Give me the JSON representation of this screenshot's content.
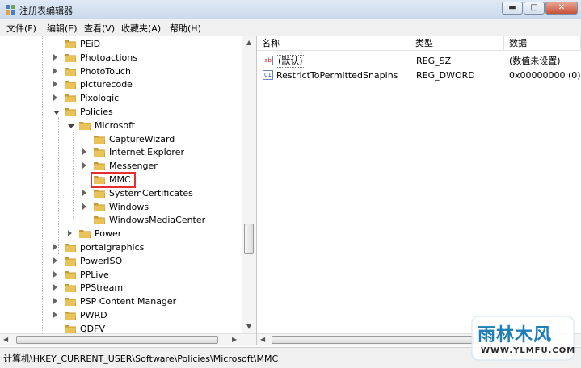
{
  "window": {
    "title": "注册表编辑器",
    "minimize_glyph": "▬",
    "maximize_glyph": "□",
    "close_glyph": "✕"
  },
  "menu": [
    "文件(F)",
    "编辑(E)",
    "查看(V)",
    "收藏夹(A)",
    "帮助(H)"
  ],
  "tree": {
    "items": [
      {
        "label": "PEiD",
        "expander": "none"
      },
      {
        "label": "Photoactions",
        "expander": "collapsed"
      },
      {
        "label": "PhotoTouch",
        "expander": "collapsed"
      },
      {
        "label": "picturecode",
        "expander": "collapsed"
      },
      {
        "label": "Pixologic",
        "expander": "collapsed"
      },
      {
        "label": "Policies",
        "expander": "expanded"
      },
      {
        "label": "Microsoft",
        "expander": "expanded"
      },
      {
        "label": "CaptureWizard",
        "expander": "none"
      },
      {
        "label": "Internet Explorer",
        "expander": "collapsed"
      },
      {
        "label": "Messenger",
        "expander": "collapsed"
      },
      {
        "label": "MMC",
        "expander": "none",
        "selected": true
      },
      {
        "label": "SystemCertificates",
        "expander": "collapsed"
      },
      {
        "label": "Windows",
        "expander": "collapsed"
      },
      {
        "label": "WindowsMediaCenter",
        "expander": "none"
      },
      {
        "label": "Power",
        "expander": "collapsed"
      },
      {
        "label": "portalgraphics",
        "expander": "collapsed"
      },
      {
        "label": "PowerISO",
        "expander": "collapsed"
      },
      {
        "label": "PPLive",
        "expander": "collapsed"
      },
      {
        "label": "PPStream",
        "expander": "collapsed"
      },
      {
        "label": "PSP Content Manager",
        "expander": "collapsed"
      },
      {
        "label": "PWRD",
        "expander": "collapsed"
      },
      {
        "label": "QDFV",
        "expander": "none"
      }
    ]
  },
  "list": {
    "columns": [
      "名称",
      "类型",
      "数据"
    ],
    "rows": [
      {
        "name": "(默认)",
        "type": "REG_SZ",
        "data": "(数值未设置)",
        "icon": "string-value-icon",
        "icon_glyph": "ab"
      },
      {
        "name": "RestrictToPermittedSnapins",
        "type": "REG_DWORD",
        "data": "0x00000000 (0)",
        "icon": "dword-value-icon",
        "icon_glyph": "01"
      }
    ]
  },
  "status": "计算机\\HKEY_CURRENT_USER\\Software\\Policies\\Microsoft\\MMC",
  "watermark": {
    "name": "雨林木风",
    "url": "WWW.YLMFU.COM"
  },
  "colors": {
    "folder": "#e9c35a",
    "folder_dark": "#c9982e",
    "highlight": "#e23030",
    "watermark": "#1e7fb6"
  }
}
